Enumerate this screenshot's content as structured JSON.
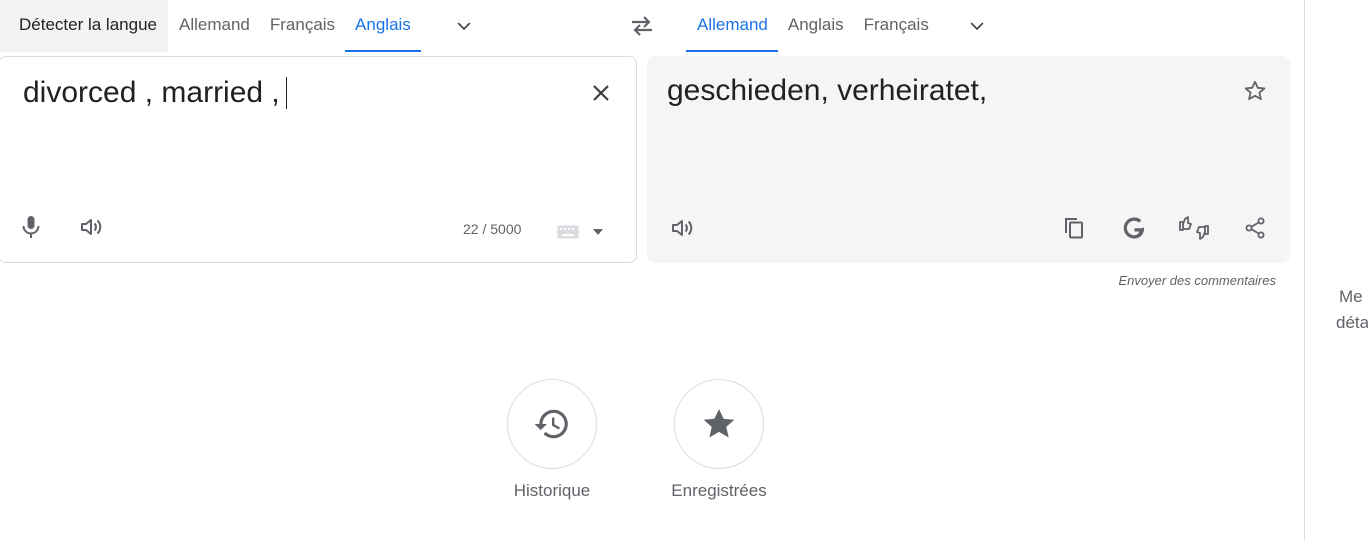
{
  "source_languages": {
    "detect_label": "Détecter la langue",
    "options": [
      "Allemand",
      "Français",
      "Anglais"
    ],
    "active": "Anglais"
  },
  "target_languages": {
    "options": [
      "Allemand",
      "Anglais",
      "Français"
    ],
    "active": "Allemand"
  },
  "source": {
    "text": "divorced , married ,",
    "char_count": "22 / 5000"
  },
  "target": {
    "text": "geschieden, verheiratet,"
  },
  "feedback_label": "Envoyer des commentaires",
  "history_label": "Historique",
  "saved_label": "Enregistrées",
  "side_panel": {
    "line1": "Me",
    "line2": "déta"
  },
  "icons": [
    "chevron-down-icon",
    "swap-icon",
    "close-icon",
    "mic-icon",
    "speaker-icon",
    "keyboard-icon",
    "star-outline-icon",
    "copy-icon",
    "google-icon",
    "rate-icon",
    "share-icon",
    "history-icon",
    "star-icon"
  ],
  "colors": {
    "accent": "#1a73e8",
    "panel_bg": "#f5f5f5",
    "icon": "#5f6368"
  }
}
